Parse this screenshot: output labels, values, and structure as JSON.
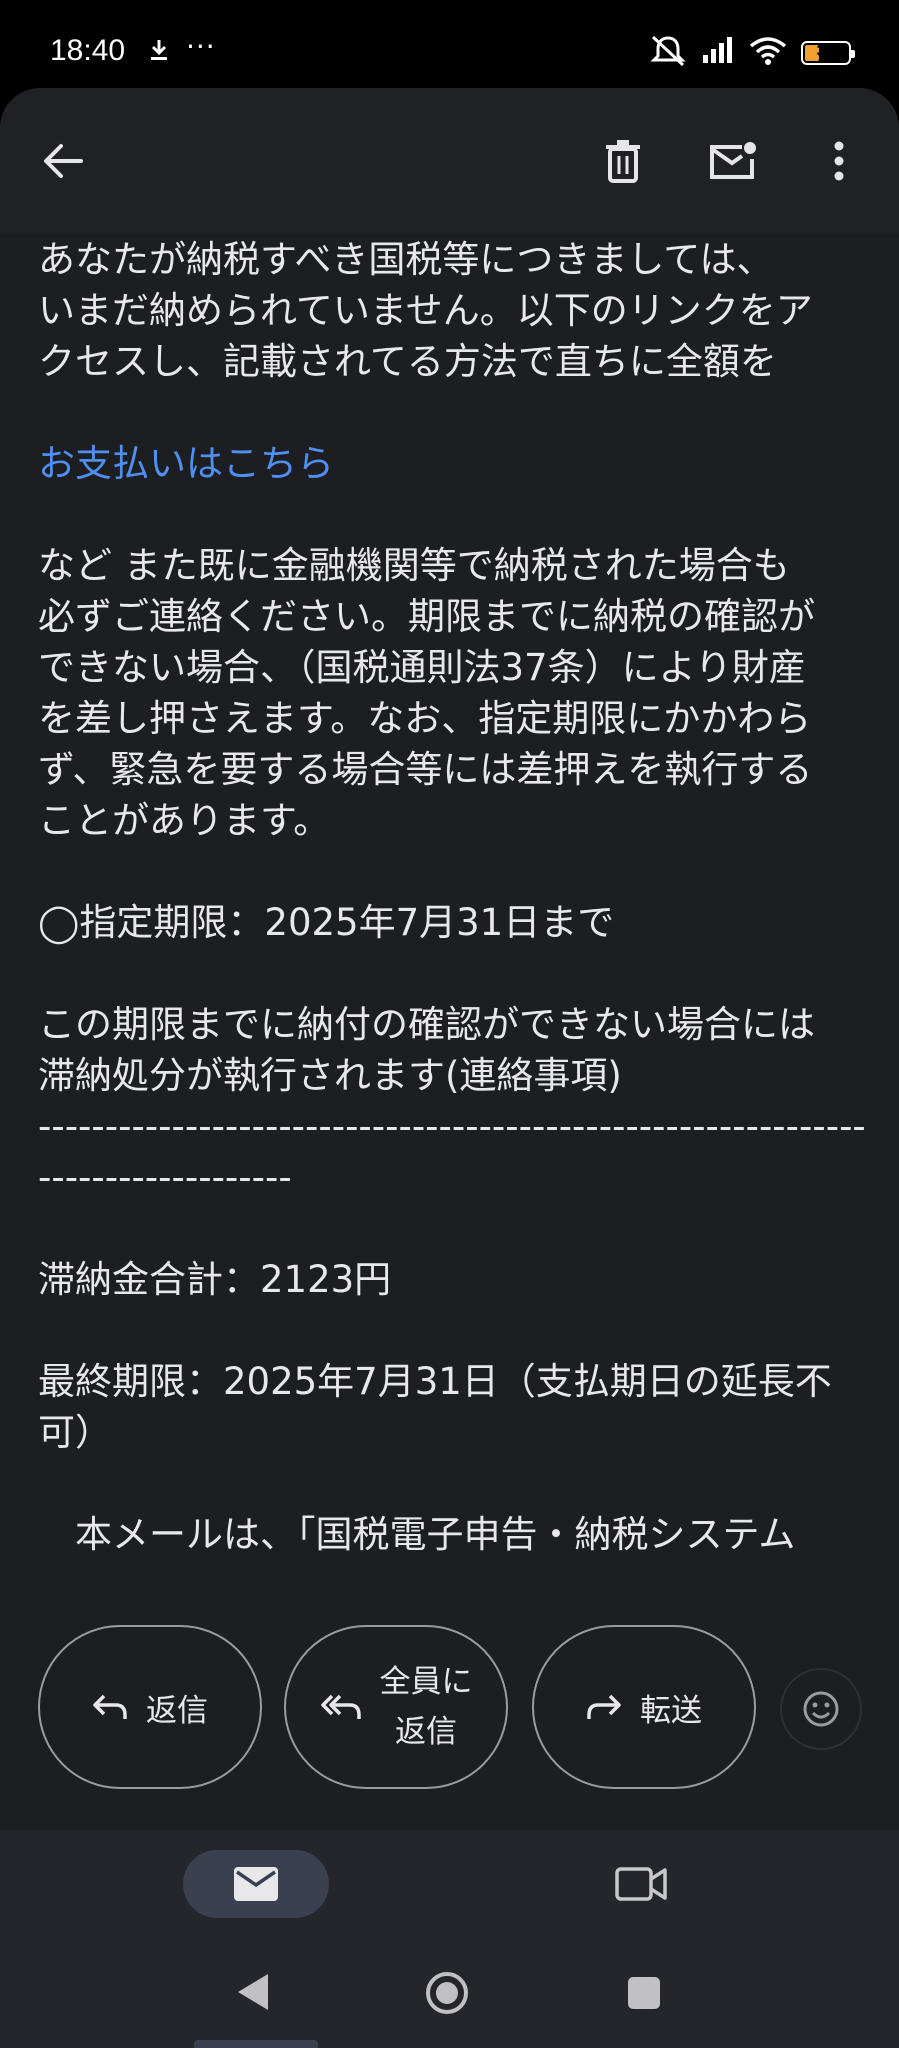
{
  "status_bar": {
    "time": "18:40",
    "more": "···",
    "battery_level": "33",
    "battery_fraction": 0.33
  },
  "app_bar": {
    "icons": [
      "back-arrow-icon",
      "delete-icon",
      "mark-unread-icon",
      "more-vert-icon"
    ]
  },
  "email": {
    "line1": " あなたが納税すべき国税等につきましては、",
    "line2": "いまだ納められていません。以下のリンクをア",
    "line3": "クセスし、記載されてる方法で直ちに全額を",
    "pay_link": " お支払いはこちら",
    "para2_line1": "など また既に金融機関等で納税された場合も",
    "para2_line2": "必ずご連絡ください。期限までに納税の確認が",
    "para2_line3": "できない場合、（国税通則法37条）により財産",
    "para2_line4": "を差し押さえます。なお、指定期限にかかわら",
    "para2_line5": "ず、緊急を要する場合等には差押えを執行する",
    "para2_line6": "ことがあります。",
    "deadline": "◯指定期限：2025年7月31日まで",
    "notice_line1": "この期限までに納付の確認ができない場合には",
    "notice_line2": "滞納処分が執行されます(連絡事項)",
    "dashes_line1": "----------------------------------------------------------------------------",
    "dashes_line2": "-------------------",
    "total": "滞納金合計：2123円",
    "final_line1": "最終期限：2025年7月31日（支払期日の延長不",
    "final_line2": "可）",
    "cut_line": "　本メールは、「国税電子申告・納税システム"
  },
  "actions": {
    "reply": "返信",
    "reply_all_line1": "全員に",
    "reply_all_line2": "返信",
    "forward": "転送"
  },
  "colors": {
    "link": "#4f8ff0",
    "background": "#1c1e22",
    "battery": "#f0a030"
  }
}
